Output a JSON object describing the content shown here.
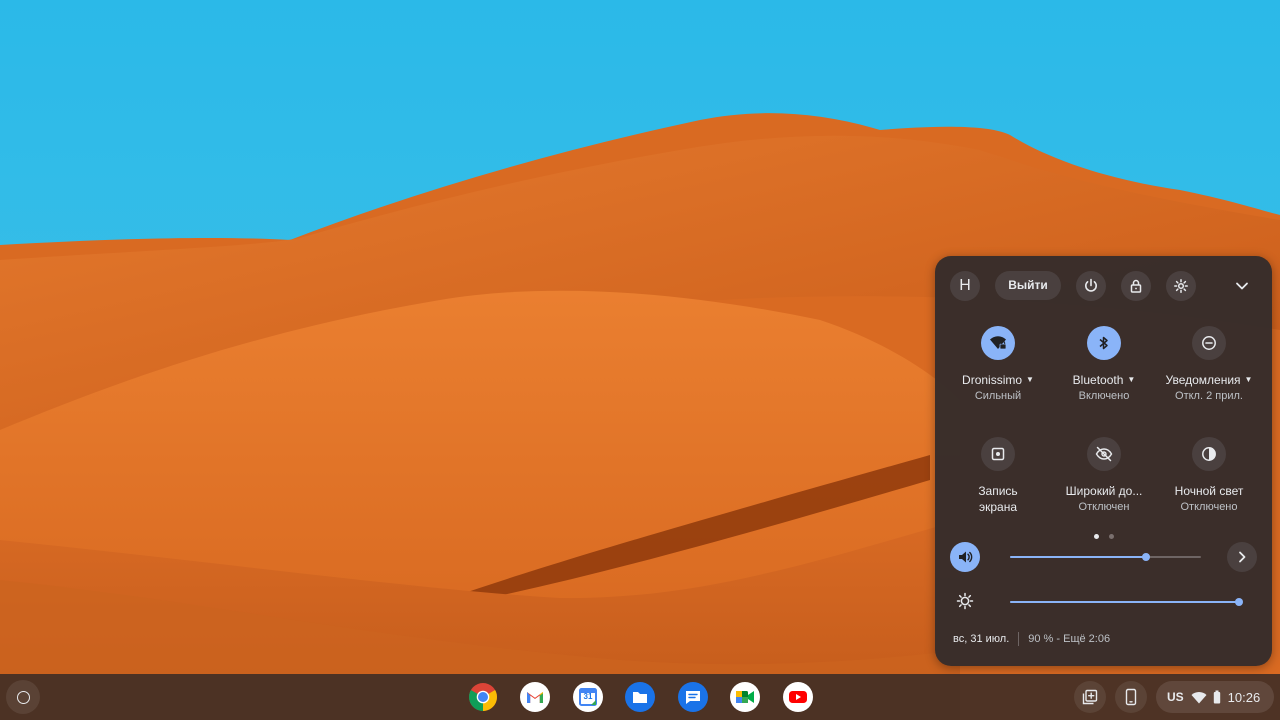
{
  "quick_settings": {
    "avatar_initial": "H",
    "signout_label": "Выйти",
    "tiles": [
      {
        "label": "Dronissimo",
        "sub": "Сильный",
        "dropdown": true,
        "on": true
      },
      {
        "label": "Bluetooth",
        "sub": "Включено",
        "dropdown": true,
        "on": true
      },
      {
        "label": "Уведомления",
        "sub": "Откл. 2 прил.",
        "dropdown": true,
        "on": false
      },
      {
        "label": "Запись экрана",
        "sub": "",
        "dropdown": false,
        "on": false
      },
      {
        "label": "Широкий до...",
        "sub": "Отключен",
        "dropdown": false,
        "on": false
      },
      {
        "label": "Ночной свет",
        "sub": "Отключено",
        "dropdown": false,
        "on": false
      }
    ],
    "volume_level": 0.71,
    "brightness_level": 1.0,
    "footer": {
      "date": "вс, 31 июл.",
      "battery": "90 % - Ещё 2:06"
    }
  },
  "shelf": {
    "apps": [
      "Chrome",
      "Gmail",
      "Calendar",
      "Files",
      "Messages",
      "Meet",
      "YouTube"
    ],
    "calendar_day": "31",
    "status": {
      "ime": "US",
      "time": "10:26"
    }
  },
  "colors": {
    "accent": "#8ab4f8",
    "panel": "#342c2b",
    "sky": "#27b6e4",
    "dune": "#e06e22"
  }
}
